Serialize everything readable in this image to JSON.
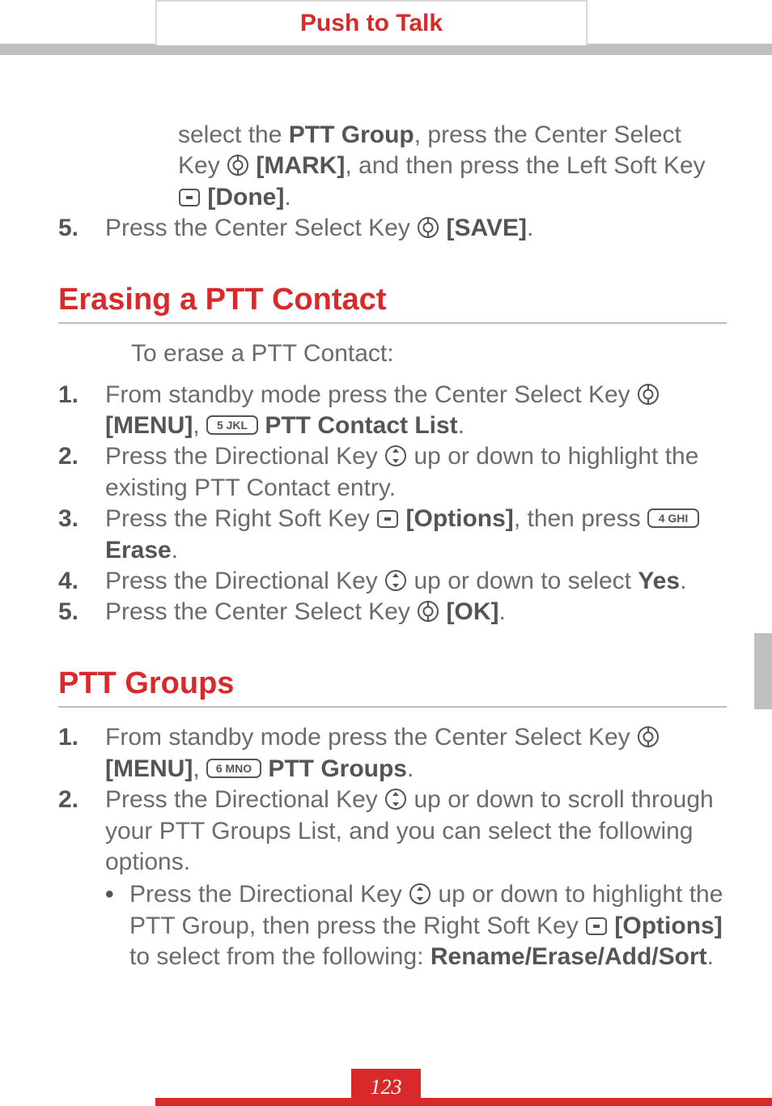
{
  "header": {
    "title": "Push to Talk"
  },
  "pre_steps": {
    "cont": {
      "part1": "select the ",
      "b1": "PTT Group",
      "part2": ", press the Center Select Key ",
      "b2": "[MARK]",
      "part3": ", and then press the Left Soft Key ",
      "b3": "[Done]",
      "part4": "."
    },
    "s5": {
      "num": "5.",
      "part1": "Press the Center Select Key ",
      "b1": "[SAVE]",
      "part2": "."
    }
  },
  "section1": {
    "heading": "Erasing a PTT Contact",
    "intro": "To erase a PTT Contact:",
    "s1": {
      "num": "1.",
      "part1": "From standby mode press the Center Select Key ",
      "b1": "[MENU]",
      "part2": ", ",
      "b2": "PTT Contact List",
      "part3": "."
    },
    "s2": {
      "num": "2.",
      "part1": "Press the Directional Key ",
      "part2": " up or down to highlight the existing PTT Contact entry."
    },
    "s3": {
      "num": "3.",
      "part1": "Press the Right Soft Key ",
      "b1": "[Options]",
      "part2": ", then press ",
      "b2": "Erase",
      "part3": "."
    },
    "s4": {
      "num": "4.",
      "part1": "Press the Directional Key ",
      "part2": " up or down to select ",
      "b1": "Yes",
      "part3": "."
    },
    "s5": {
      "num": "5.",
      "part1": "Press the Center Select Key ",
      "b1": "[OK]",
      "part2": "."
    }
  },
  "section2": {
    "heading": "PTT Groups",
    "s1": {
      "num": "1.",
      "part1": "From standby mode press the Center Select Key ",
      "b1": "[MENU]",
      "part2": ", ",
      "b2": "PTT Groups",
      "part3": "."
    },
    "s2": {
      "num": "2.",
      "part1": "Press the Directional Key ",
      "part2": " up or down to scroll through your PTT Groups List, and you can select the following options."
    },
    "bullet": {
      "part1": "Press the Directional Key ",
      "part2": " up or down to highlight the PTT Group, then press the Right Soft Key ",
      "b1": "[Options]",
      "part3": " to select from the following: ",
      "b2": "Rename/Erase/Add/Sort",
      "part4": "."
    }
  },
  "key_labels": {
    "key5": "5 JKL",
    "key4": "4 GHI",
    "key6": "6 MNO"
  },
  "page_number": "123"
}
